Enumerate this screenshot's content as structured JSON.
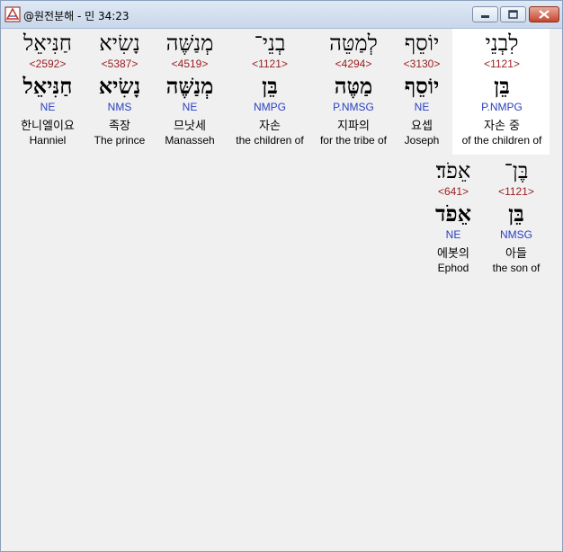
{
  "window": {
    "title": "@원전분해 - 민 34:23"
  },
  "words": [
    {
      "heb_top": "לִבְנֵי",
      "strong": "<1121>",
      "heb_bottom": "בֵּן",
      "morph": "P.NMPG",
      "korean": "자손 중",
      "english": "of the children of"
    },
    {
      "heb_top": "יוֹסֵף",
      "strong": "<3130>",
      "heb_bottom": "יוֹסֵף",
      "morph": "NE",
      "korean": "요셉",
      "english": "Joseph"
    },
    {
      "heb_top": "לְמַטֵּה",
      "strong": "<4294>",
      "heb_bottom": "מַטֶּה",
      "morph": "P.NMSG",
      "korean": "지파의",
      "english": "for the tribe of"
    },
    {
      "heb_top": "בְנֵי־",
      "strong": "<1121>",
      "heb_bottom": "בֵּן",
      "morph": "NMPG",
      "korean": "자손",
      "english": "the children of"
    },
    {
      "heb_top": "מְנַשֶּׁה",
      "strong": "<4519>",
      "heb_bottom": "מְנַשֶּׁה",
      "morph": "NE",
      "korean": "므낫세",
      "english": "Manasseh"
    },
    {
      "heb_top": "נָשִׂיא",
      "strong": "<5387>",
      "heb_bottom": "נָשִׂיא",
      "morph": "NMS",
      "korean": "족장",
      "english": "The prince"
    },
    {
      "heb_top": "חַנִּיאֵל",
      "strong": "<2592>",
      "heb_bottom": "חַנִּיאֵל",
      "morph": "NE",
      "korean": "한니엘이요",
      "english": "Hanniel"
    },
    {
      "heb_top": "בֶּן־",
      "strong": "<1121>",
      "heb_bottom": "בֵּן",
      "morph": "NMSG",
      "korean": "아들",
      "english": "the son of"
    },
    {
      "heb_top": "אֵפֹד׃",
      "strong": "<641>",
      "heb_bottom": "אֵפֹד",
      "morph": "NE",
      "korean": "에봇의",
      "english": "Ephod"
    }
  ]
}
